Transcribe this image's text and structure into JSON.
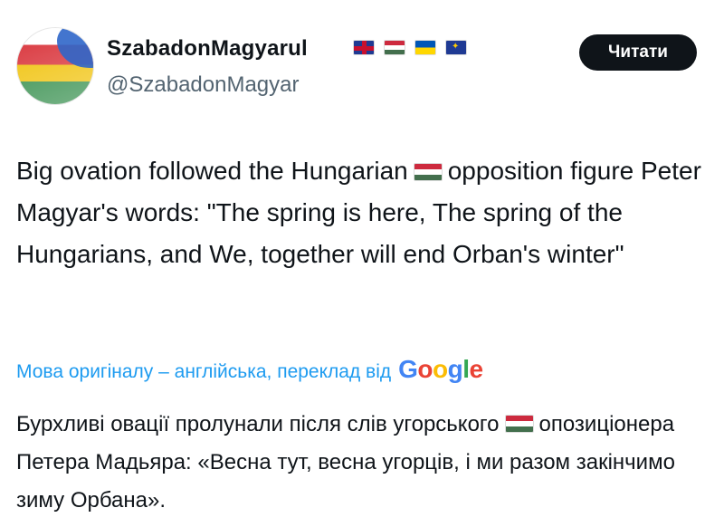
{
  "author": {
    "display_name": "SzabadonMagyarul",
    "handle": "@SzabadonMagyar",
    "flags": [
      "uk-flag-icon",
      "hungary-flag-icon",
      "ukraine-flag-icon",
      "eu-flag-icon"
    ]
  },
  "follow_button": {
    "label": "Читати"
  },
  "tweet": {
    "text_part1": "Big ovation followed the Hungarian",
    "text_part2": "opposition figure Peter Magyar's words: \"The spring is here, The spring of the Hungarians, and We, together will end Orban's winter\""
  },
  "translation_note": {
    "label": "Мова оригіналу – англійська, переклад від",
    "provider_letters": [
      "G",
      "o",
      "o",
      "g",
      "l",
      "e"
    ]
  },
  "translation": {
    "text_part1": "Бурхливі овації пролунали після слів угорського",
    "text_part2": "опозиціонера Петера Мадьяра: «Весна тут, весна угорців, і ми разом закінчимо зиму Орбана»."
  },
  "colors": {
    "link": "#1d9bf0",
    "secondary_text": "#536471",
    "primary_text": "#0f1419",
    "button_bg": "#0f1419"
  }
}
